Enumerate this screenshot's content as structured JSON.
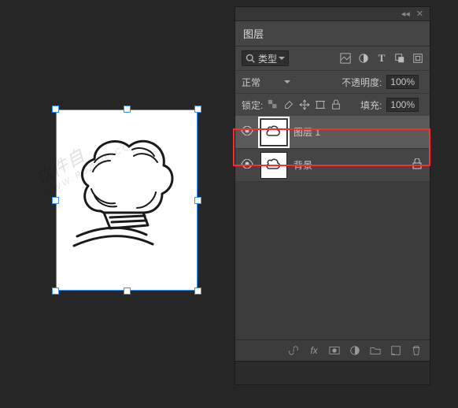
{
  "panel": {
    "title": "图层",
    "search_label": "类型",
    "blend_mode": "正常",
    "opacity_label": "不透明度:",
    "opacity_value": "100%",
    "lock_label": "锁定:",
    "fill_label": "填充:",
    "fill_value": "100%"
  },
  "layers": [
    {
      "name": "图层 1",
      "visible": true,
      "locked": false,
      "selected": true
    },
    {
      "name": "背景",
      "visible": true,
      "locked": true,
      "selected": false
    }
  ],
  "icons": {
    "image_filter": "image-icon",
    "adj_filter": "circle-half-icon",
    "type_filter": "T",
    "shape_filter": "shape-icon",
    "smart_filter": "smart-icon"
  },
  "watermark": {
    "line1": "软件自",
    "line2": "WWW.RJZXW.CC"
  }
}
